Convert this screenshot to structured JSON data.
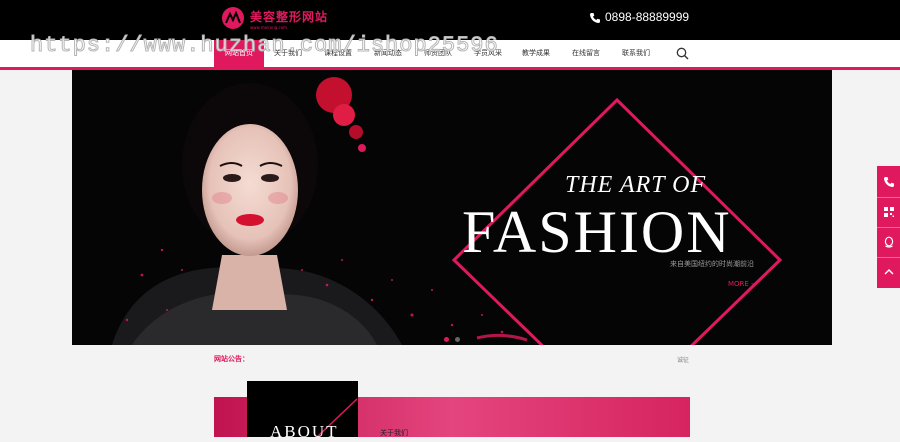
{
  "header": {
    "logo_text": "美容整形网站",
    "logo_sub": "www.meirong.com",
    "phone": "0898-88889999"
  },
  "watermark": "https://www.huzhan.com/ishop25596",
  "nav": {
    "items": [
      {
        "label": "网站首页",
        "active": true
      },
      {
        "label": "关于我们"
      },
      {
        "label": "课程设置"
      },
      {
        "label": "新闻动态"
      },
      {
        "label": "师资团队"
      },
      {
        "label": "学员风采"
      },
      {
        "label": "教学成果"
      },
      {
        "label": "在线留言"
      },
      {
        "label": "联系我们"
      }
    ]
  },
  "banner": {
    "line1": "THE ART OF",
    "line2": "FASHION",
    "subtitle": "来自美国纽约的时尚潮前沿",
    "more": "MORE →"
  },
  "notice": {
    "label": "网站公告：",
    "right": "诚征"
  },
  "about": {
    "word": "ABOUT",
    "label": "关于我们"
  },
  "colors": {
    "accent": "#e0195f",
    "topbar": "#000000",
    "page_bg": "#f3f3f3"
  },
  "side_icons": [
    "phone-icon",
    "qrcode-icon",
    "qq-icon",
    "back-to-top-icon"
  ]
}
